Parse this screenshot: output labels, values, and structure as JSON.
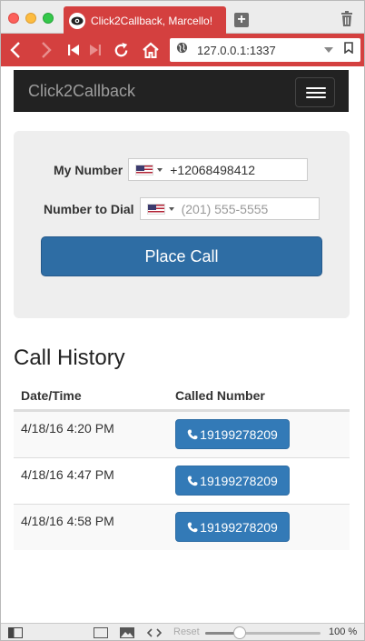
{
  "browser": {
    "tab_title": "Click2Callback, Marcello!",
    "url": "127.0.0.1:1337",
    "zoom_label": "100 %",
    "zoom_fraction": 0.27,
    "reset_label": "Reset"
  },
  "navbar": {
    "brand": "Click2Callback"
  },
  "form": {
    "my_number_label": "My Number",
    "my_number_value": "+12068498412",
    "dial_label": "Number to Dial",
    "dial_placeholder": "(201) 555-5555",
    "place_call_label": "Place Call"
  },
  "history": {
    "title": "Call History",
    "columns": [
      "Date/Time",
      "Called Number"
    ],
    "rows": [
      {
        "datetime": "4/18/16 4:20 PM",
        "number": "19199278209"
      },
      {
        "datetime": "4/18/16 4:47 PM",
        "number": "19199278209"
      },
      {
        "datetime": "4/18/16 4:58 PM",
        "number": "19199278209"
      }
    ]
  },
  "colors": {
    "browser_accent": "#d4403f",
    "navbar_bg": "#222222",
    "primary_button": "#2e6da4",
    "call_button": "#337ab7"
  },
  "icons": [
    "eye-icon",
    "new-tab-icon",
    "trash-icon",
    "back-icon",
    "forward-icon",
    "skip-back-icon",
    "skip-forward-icon",
    "reload-icon",
    "home-icon",
    "globe-icon",
    "bookmark-icon",
    "menu-icon",
    "phone-icon",
    "us-flag-icon",
    "sidebar-toggle-icon",
    "screen-icon",
    "image-icon",
    "code-icon"
  ]
}
